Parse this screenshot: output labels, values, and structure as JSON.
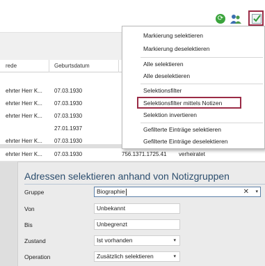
{
  "toolbar": {
    "refresh_icon_glyph": "⟳",
    "select_icon": "check-box-icon",
    "highlight_color": "#9a2b46"
  },
  "grid": {
    "columns": [
      "rede",
      "Geburtsdatum"
    ],
    "rows": [
      {
        "salutation": "",
        "birthdate": ""
      },
      {
        "salutation": "ehrter Herr K...",
        "birthdate": "07.03.1930"
      },
      {
        "salutation": "ehrter Herr K...",
        "birthdate": "07.03.1930"
      },
      {
        "salutation": "ehrter Herr K...",
        "birthdate": "07.03.1930"
      },
      {
        "salutation": "",
        "birthdate": "27.01.1937"
      },
      {
        "salutation": "ehrter Herr K...",
        "birthdate": "07.03.1930"
      },
      {
        "salutation": "",
        "birthdate": ""
      }
    ],
    "last_row": {
      "salutation": "ehrter Herr K...",
      "birthdate": "07.03.1930",
      "number": "756.1371.1725.41",
      "status": "verheiratet"
    }
  },
  "menu": {
    "items": [
      "Markierung selektieren",
      "Markierung deselektieren",
      "Alle selektieren",
      "Alle deselektieren",
      "Selektionsfilter",
      "Selektionsfilter mittels Notizen",
      "Selektion invertieren",
      "Gefilterte Einträge selektieren",
      "Gefilterte Einträge deselektieren"
    ]
  },
  "panel": {
    "title": "Adressen selektieren anhand von Notizgruppen",
    "fields": [
      {
        "label": "Gruppe",
        "value": "Biographie"
      },
      {
        "label": "Von",
        "value": "Unbekannt"
      },
      {
        "label": "Bis",
        "value": "Unbegrenzt"
      },
      {
        "label": "Zustand",
        "value": "Ist vorhanden"
      },
      {
        "label": "Operation",
        "value": "Zusätzlich selektieren"
      }
    ],
    "clear_glyph": "✕",
    "dropdown_glyph": "▾"
  }
}
